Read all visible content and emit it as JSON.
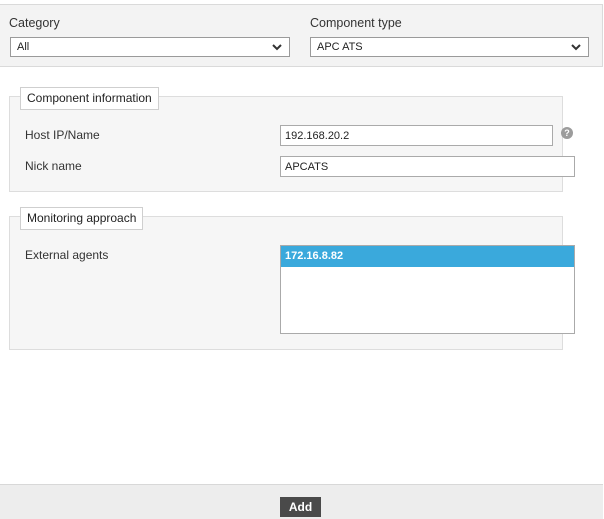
{
  "filters": {
    "category_label": "Category",
    "category_value": "All",
    "component_type_label": "Component type",
    "component_type_value": "APC ATS"
  },
  "component_information": {
    "legend": "Component information",
    "host_label": "Host IP/Name",
    "host_value": "192.168.20.2",
    "help_icon": "question-circle-icon",
    "help_glyph": "?",
    "nick_label": "Nick name",
    "nick_value": "APCATS"
  },
  "monitoring_approach": {
    "legend": "Monitoring approach",
    "agents_label": "External agents",
    "agents": [
      "172.16.8.82"
    ],
    "selected_index": 0
  },
  "footer": {
    "add_label": "Add"
  },
  "colors": {
    "selected_item": "#3aa9dc",
    "add_button": "#4a4a4a"
  }
}
